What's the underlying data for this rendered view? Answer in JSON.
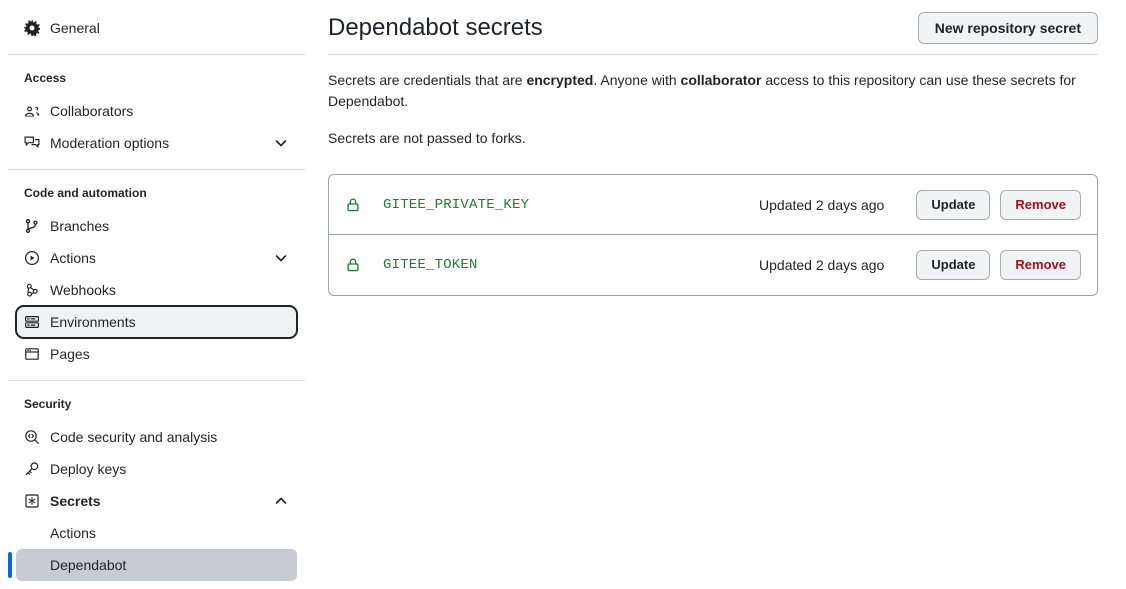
{
  "sidebar": {
    "top_items": [
      {
        "label": "General",
        "icon": "gear-icon",
        "name": "general"
      }
    ],
    "sections": [
      {
        "title": "Access",
        "items": [
          {
            "label": "Collaborators",
            "icon": "people-icon",
            "name": "collaborators",
            "chevron": ""
          },
          {
            "label": "Moderation options",
            "icon": "comment-discussion-icon",
            "name": "moderation-options",
            "chevron": "down"
          }
        ]
      },
      {
        "title": "Code and automation",
        "items": [
          {
            "label": "Branches",
            "icon": "git-branch-icon",
            "name": "branches",
            "chevron": ""
          },
          {
            "label": "Actions",
            "icon": "play-circle-icon",
            "name": "actions",
            "chevron": "down"
          },
          {
            "label": "Webhooks",
            "icon": "webhook-icon",
            "name": "webhooks",
            "chevron": ""
          },
          {
            "label": "Environments",
            "icon": "server-icon",
            "name": "environments",
            "chevron": "",
            "state": "focused"
          },
          {
            "label": "Pages",
            "icon": "browser-icon",
            "name": "pages",
            "chevron": ""
          }
        ]
      },
      {
        "title": "Security",
        "items": [
          {
            "label": "Code security and analysis",
            "icon": "codescan-icon",
            "name": "code-security-and-analysis",
            "chevron": ""
          },
          {
            "label": "Deploy keys",
            "icon": "key-icon",
            "name": "deploy-keys",
            "chevron": ""
          },
          {
            "label": "Secrets",
            "icon": "asterisk-box-icon",
            "name": "secrets",
            "chevron": "up",
            "bold": true
          }
        ],
        "subitems": [
          {
            "label": "Actions",
            "name": "secrets-actions",
            "state": ""
          },
          {
            "label": "Dependabot",
            "name": "secrets-dependabot",
            "state": "selected"
          }
        ]
      }
    ]
  },
  "main": {
    "title": "Dependabot secrets",
    "new_secret_button": "New repository secret",
    "description": {
      "part1": "Secrets are credentials that are ",
      "bold1": "encrypted",
      "part2": ". Anyone with ",
      "bold2": "collaborator",
      "part3": " access to this repository can use these secrets for Dependabot."
    },
    "forks_note": "Secrets are not passed to forks.",
    "secrets": [
      {
        "name": "GITEE_PRIVATE_KEY",
        "updated": "Updated 2 days ago",
        "update_label": "Update",
        "remove_label": "Remove"
      },
      {
        "name": "GITEE_TOKEN",
        "updated": "Updated 2 days ago",
        "update_label": "Update",
        "remove_label": "Remove"
      }
    ]
  },
  "colors": {
    "accent": "#0969da",
    "secret_green": "#1a7f37",
    "danger": "#a40e26",
    "border": "#d1d9e0",
    "selected_bg": "#c8ccd2"
  }
}
